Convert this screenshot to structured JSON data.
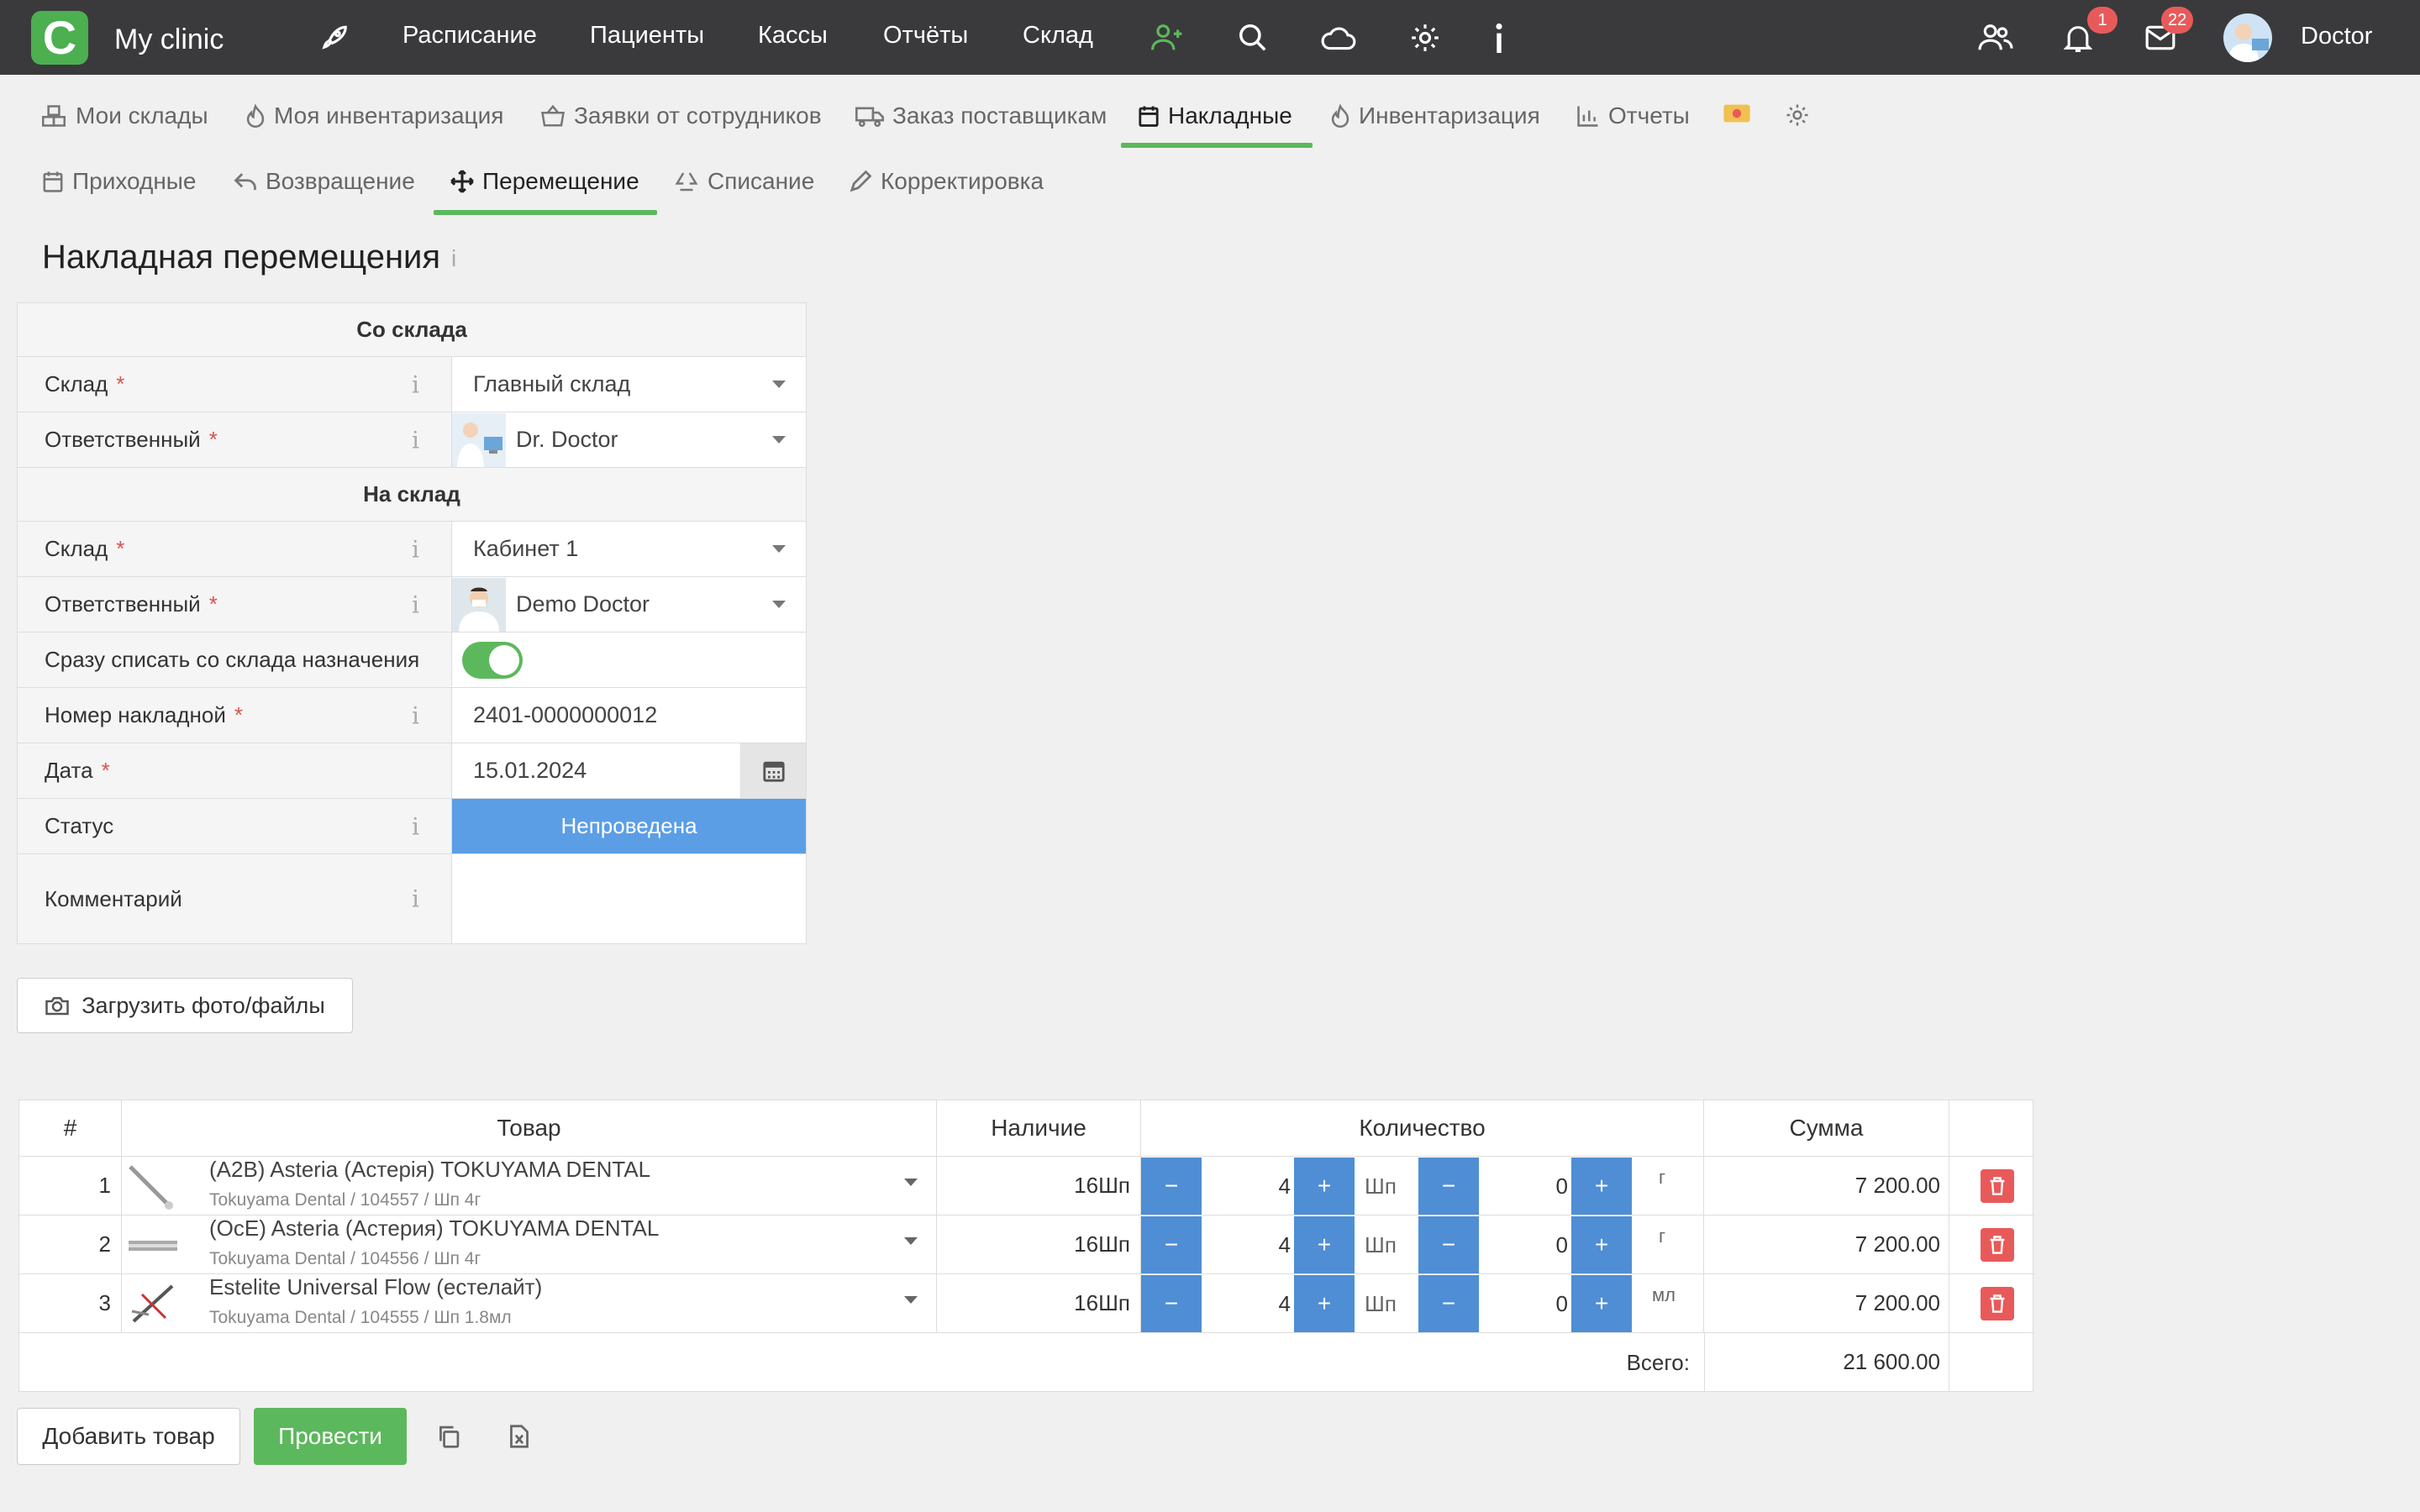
{
  "app": {
    "logo_letter": "C",
    "name": "My clinic"
  },
  "nav": {
    "items": [
      "Расписание",
      "Пациенты",
      "Кассы",
      "Отчёты",
      "Склад"
    ],
    "notifications_count": "1",
    "messages_count": "22",
    "user_name": "Doctor"
  },
  "tabs": {
    "primary": [
      "Мои склады",
      "Моя инвентаризация",
      "Заявки от сотрудников",
      "Заказ поставщикам",
      "Накладные",
      "Инвентаризация",
      "Отчеты"
    ],
    "primary_active": "Накладные",
    "secondary": [
      "Приходные",
      "Возвращение",
      "Перемещение",
      "Списание",
      "Корректировка"
    ],
    "secondary_active": "Перемещение"
  },
  "page": {
    "title": "Накладная перемещения",
    "info_glyph": "i"
  },
  "form": {
    "section_from": "Со склада",
    "section_to": "На склад",
    "required_mark": "*",
    "info_glyph": "i",
    "from_warehouse_label": "Склад",
    "from_warehouse_value": "Главный склад",
    "from_responsible_label": "Ответственный",
    "from_responsible_value": "Dr. Doctor",
    "to_warehouse_label": "Склад",
    "to_warehouse_value": "Кабинет 1",
    "to_responsible_label": "Ответственный",
    "to_responsible_value": "Demo Doctor",
    "writeoff_label": "Сразу списать со склада назначения",
    "writeoff_on": true,
    "invoice_number_label": "Номер накладной",
    "invoice_number_value": "2401-0000000012",
    "date_label": "Дата",
    "date_value": "15.01.2024",
    "status_label": "Статус",
    "status_value": "Непроведена",
    "comment_label": "Комментарий",
    "comment_value": ""
  },
  "upload_label": "Загрузить фото/файлы",
  "table": {
    "headers": {
      "num": "#",
      "product": "Товар",
      "stock": "Наличие",
      "quantity": "Количество",
      "sum": "Сумма"
    },
    "rows": [
      {
        "num": "1",
        "name": "(A2B) Asteria (Астерія) TOKUYAMA DENTAL",
        "meta": "Tokuyama Dental  /  104557  /  Шп 4г",
        "stock": "16Шп",
        "qty_main": "4",
        "unit_main": "Шп",
        "qty_sub": "0",
        "unit_sub": "г",
        "sum": "7 200.00"
      },
      {
        "num": "2",
        "name": "(OcE) Asteria (Астерия) TOKUYAMA DENTAL",
        "meta": "Tokuyama Dental  /  104556  /  Шп 4г",
        "stock": "16Шп",
        "qty_main": "4",
        "unit_main": "Шп",
        "qty_sub": "0",
        "unit_sub": "г",
        "sum": "7 200.00"
      },
      {
        "num": "3",
        "name": "Estelite Universal Flow (естелайт)",
        "meta": "Tokuyama Dental  /  104555  /  Шп 1.8мл",
        "stock": "16Шп",
        "qty_main": "4",
        "unit_main": "Шп",
        "qty_sub": "0",
        "unit_sub": "мл",
        "sum": "7 200.00"
      }
    ],
    "minus_glyph": "−",
    "plus_glyph": "+",
    "total_label": "Всего:",
    "total_value": "21 600.00"
  },
  "actions": {
    "add_product": "Добавить товар",
    "post": "Провести"
  },
  "colors": {
    "topbar": "#3a3a3c",
    "accent_green": "#5cb85c",
    "qty_button": "#4f8ed4",
    "status_blue": "#5b9ee6",
    "danger": "#e85a5a"
  }
}
